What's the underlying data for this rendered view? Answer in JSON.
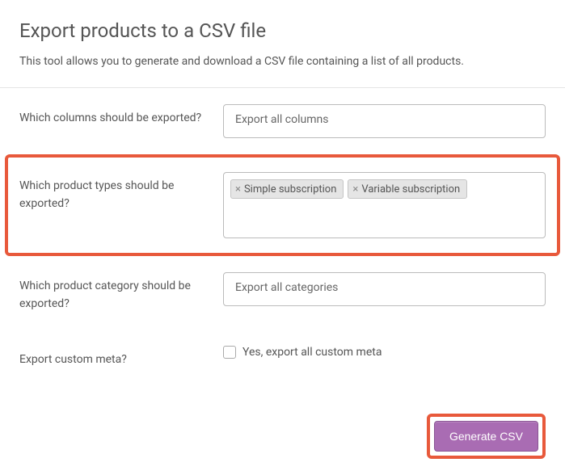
{
  "header": {
    "title": "Export products to a CSV file",
    "description": "This tool allows you to generate and download a CSV file containing a list of all products."
  },
  "form": {
    "columns": {
      "label": "Which columns should be exported?",
      "value": "Export all columns"
    },
    "productTypes": {
      "label": "Which product types should be exported?",
      "tags": [
        "Simple subscription",
        "Variable subscription"
      ]
    },
    "category": {
      "label": "Which product category should be exported?",
      "value": "Export all categories"
    },
    "customMeta": {
      "label": "Export custom meta?",
      "checkboxLabel": "Yes, export all custom meta"
    }
  },
  "actions": {
    "generateLabel": "Generate CSV"
  }
}
